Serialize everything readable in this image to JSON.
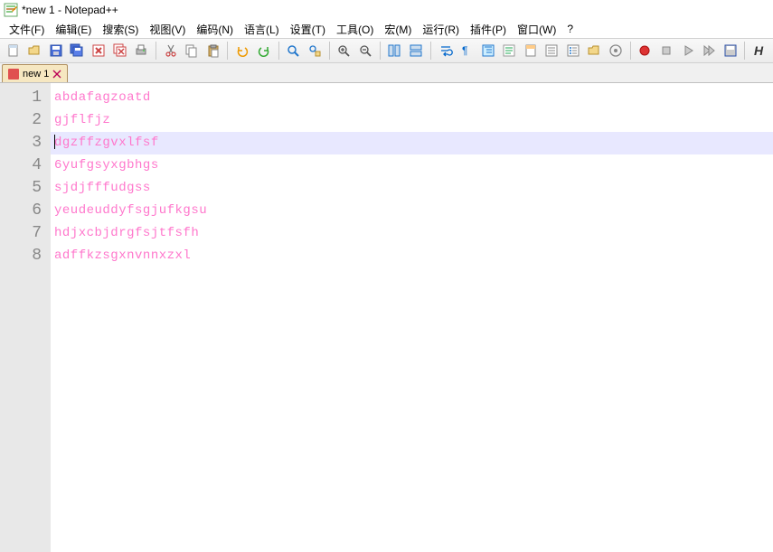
{
  "window": {
    "title": "*new 1 - Notepad++"
  },
  "menu": {
    "file": "文件(F)",
    "edit": "编辑(E)",
    "search": "搜索(S)",
    "view": "视图(V)",
    "encoding": "编码(N)",
    "language": "语言(L)",
    "settings": "设置(T)",
    "tools": "工具(O)",
    "macro": "宏(M)",
    "run": "运行(R)",
    "plugins": "插件(P)",
    "window": "窗口(W)",
    "help": "?"
  },
  "tabs": [
    {
      "label": "new 1",
      "modified": true
    }
  ],
  "editor": {
    "current_line_index": 2,
    "lines": [
      "abdafagzoatd",
      "gjflfjz",
      "dgzffzgvxlfsf",
      "6yufgsyxgbhgs",
      "sjdjfffudgss",
      "yeudeuddyfsgjufkgsu",
      "hdjxcbjdrgfsjtfsfh",
      "adffkzsgxnvnnxzxl"
    ]
  },
  "colors": {
    "text_pink": "#ff77cc",
    "current_line_bg": "#e8e8ff",
    "gutter_bg": "#e8e8e8"
  }
}
